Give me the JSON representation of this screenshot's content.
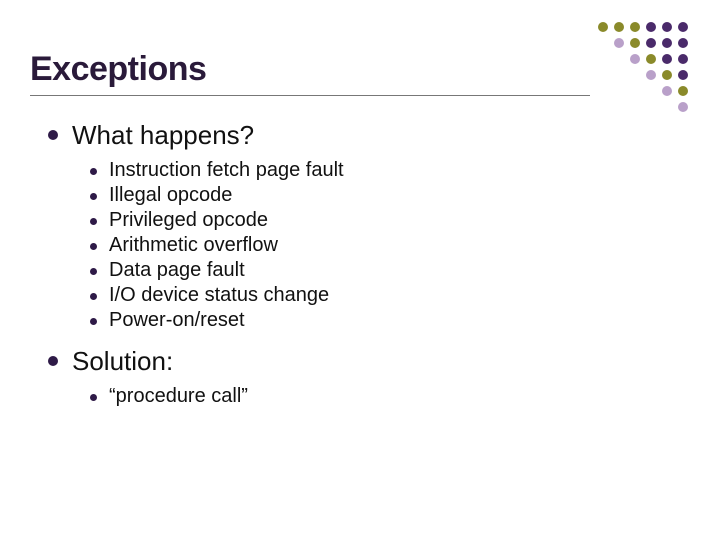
{
  "title": "Exceptions",
  "sections": [
    {
      "heading": "What happens?",
      "items": [
        "Instruction fetch page fault",
        "Illegal opcode",
        "Privileged opcode",
        "Arithmetic overflow",
        "Data page fault",
        "I/O device status change",
        "Power-on/reset"
      ]
    },
    {
      "heading": "Solution:",
      "items": [
        "“procedure call”"
      ]
    }
  ],
  "decor": {
    "colors": {
      "olive": "#8a8a2a",
      "purple": "#4a2a6a",
      "mauve": "#b9a0c9",
      "white": "#ffffff"
    }
  }
}
